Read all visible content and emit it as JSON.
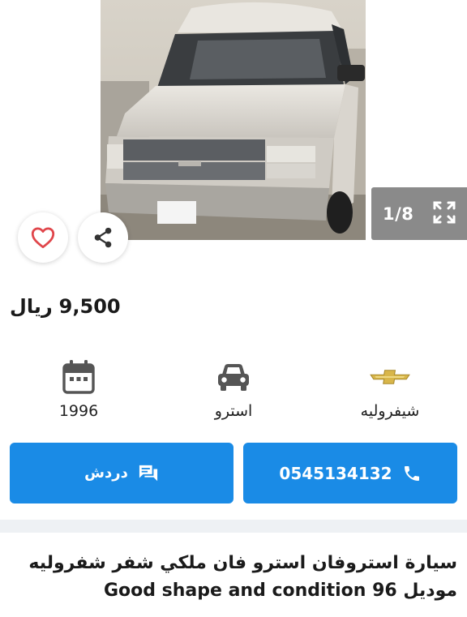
{
  "gallery": {
    "counter": "1/8",
    "icons": {
      "prev": "chevron-left-icon",
      "next": "chevron-right-icon",
      "expand": "expand-icon",
      "favorite": "heart-icon",
      "share": "share-icon"
    }
  },
  "listing": {
    "price": "9,500",
    "currency": "ريال"
  },
  "specs": {
    "year": "1996",
    "model": "استرو",
    "make": "شيفروليه",
    "icons": {
      "year": "calendar-icon",
      "model": "car-icon",
      "make": "chevrolet-logo-icon"
    }
  },
  "actions": {
    "call_label": "0545134132",
    "chat_label": "دردش",
    "icons": {
      "call": "phone-icon",
      "chat": "chat-icon"
    }
  },
  "description": {
    "line1": "سيارة استروفان استرو فان ملكي شفر شفروليه",
    "line2": "موديل 96 Good shape and condition"
  },
  "colors": {
    "accent": "#1a8be6",
    "counter_bg": "#8a8a8a",
    "heart": "#e0464b",
    "chevrolet_gold": "#d8b64a",
    "band": "#eef1f4"
  }
}
